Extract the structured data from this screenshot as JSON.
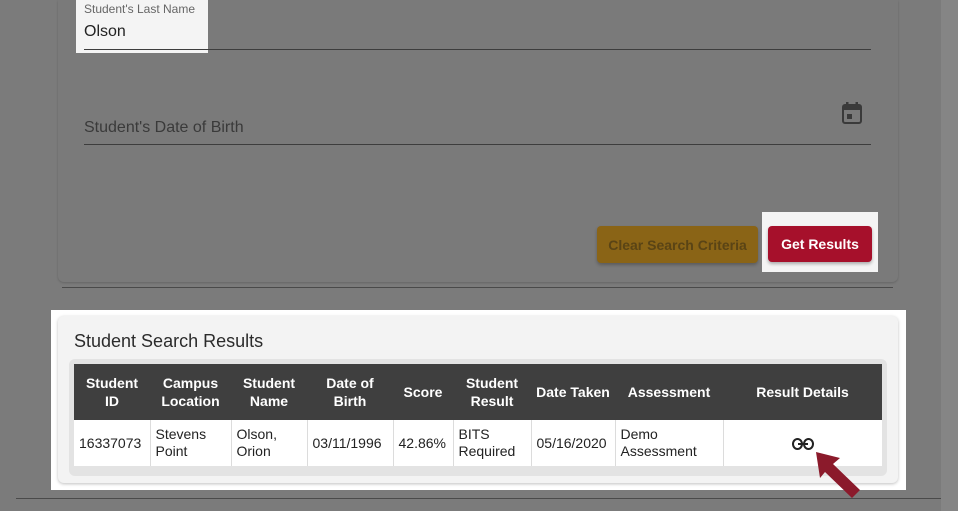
{
  "search": {
    "last_name_label": "Student's Last Name",
    "last_name_value": "Olson",
    "dob_label": "Student's Date of Birth",
    "clear_label": "Clear Search Criteria",
    "get_label": "Get Results"
  },
  "results": {
    "title": "Student Search Results",
    "headers": [
      "Student ID",
      "Campus Location",
      "Student Name",
      "Date of Birth",
      "Score",
      "Student Result",
      "Date Taken",
      "Assessment",
      "Result Details"
    ],
    "rows": [
      {
        "student_id": "16337073",
        "campus": "Stevens Point",
        "name": "Olson, Orion",
        "dob": "03/11/1996",
        "score": "42.86%",
        "result": "BITS Required",
        "date_taken": "05/16/2020",
        "assessment": "Demo Assessment",
        "details_icon": "link-icon"
      }
    ]
  },
  "colors": {
    "accent_red": "#a6102b",
    "clear_button": "#8a6416",
    "header_dark": "#3f3f3f",
    "arrow": "#8b1a2b"
  }
}
